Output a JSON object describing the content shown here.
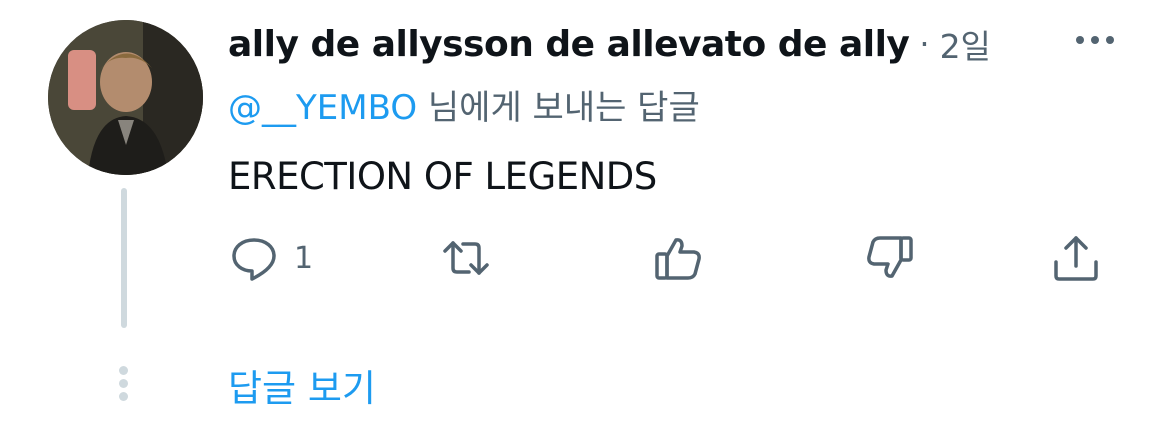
{
  "tweet": {
    "display_name": "ally de allysson de allevato de ally",
    "separator": "·",
    "time": "2일",
    "reply_to": {
      "mention": "@__YEMBO",
      "suffix": " 님에게 보내는 답글"
    },
    "text": "ERECTION OF LEGENDS",
    "actions": {
      "reply_count": "1"
    },
    "show_replies": "답글 보기"
  },
  "icons": [
    "more-icon",
    "reply-icon",
    "retweet-icon",
    "like-icon",
    "dislike-icon",
    "share-icon"
  ],
  "colors": {
    "accent": "#1d9bf0",
    "secondary_text": "#536471",
    "primary_text": "#0f1419",
    "thread_line": "#cfd9de"
  }
}
